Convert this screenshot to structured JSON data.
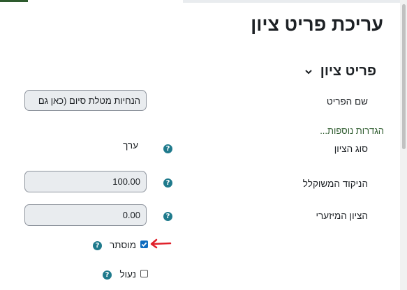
{
  "page": {
    "title": "עריכת פריט ציון"
  },
  "section": {
    "title": "פריט ציון",
    "icon": "chevron-down-icon"
  },
  "fields": {
    "item_name": {
      "label": "שם הפריט",
      "value": "הנחיות מטלת סיום (כאן גם"
    },
    "more_settings_link": "הגדרות נוספות...",
    "grade_type": {
      "label": "סוג הציון",
      "value": "ערך",
      "help_icon": "help-icon"
    },
    "weighted_grade": {
      "label": "הניקוד המשוקלל",
      "value": "100.00",
      "help_icon": "help-icon"
    },
    "min_grade": {
      "label": "הציון המיזערי",
      "value": "0.00",
      "help_icon": "help-icon"
    },
    "hidden": {
      "label": "מוסתר",
      "checked": true,
      "help_icon": "help-icon"
    },
    "locked": {
      "label": "נעול",
      "checked": false,
      "help_icon": "help-icon"
    }
  },
  "annotation": {
    "icon": "red-arrow-icon",
    "color": "#e0202a"
  },
  "colors": {
    "help": "#1f7a8c",
    "link": "#2e5b2e",
    "checkbox": "#0f6cbf"
  }
}
